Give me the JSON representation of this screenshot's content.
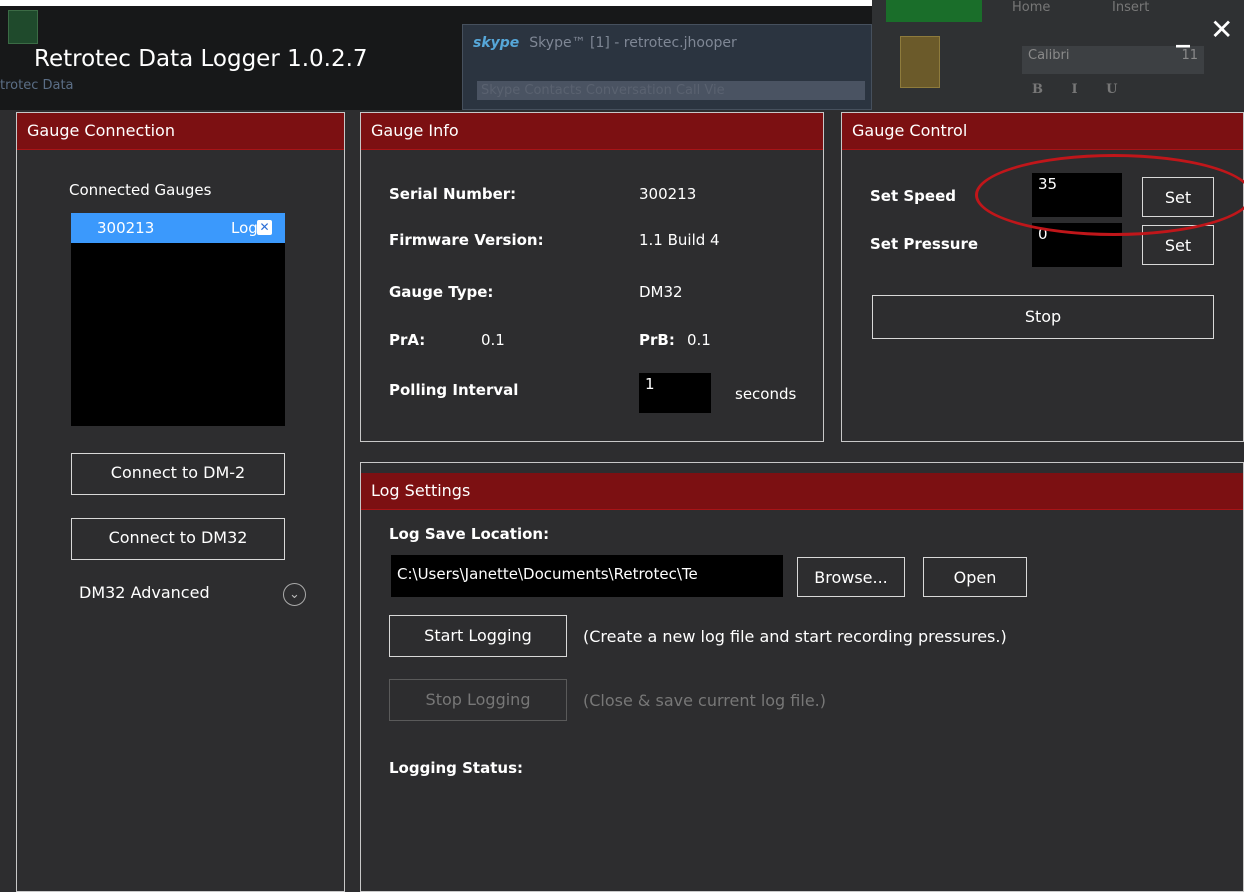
{
  "background": {
    "left_text": "trotec Data",
    "skype_logo": "skype",
    "skype_title": "Skype™ [1] - retrotec.jhooper",
    "skype_menu": "Skype   Contacts   Conversation   Call   Vie",
    "office_home": "Home",
    "office_insert": "Insert",
    "office_font": "Calibri",
    "office_size": "11",
    "office_format": "B I U"
  },
  "window": {
    "title": "Retrotec Data Logger 1.0.2.7",
    "minimize": "_",
    "close": "✕"
  },
  "gauge_connection": {
    "header": "Gauge Connection",
    "list_label": "Connected Gauges",
    "gauges": [
      {
        "serial": "300213",
        "log_label": "Log"
      }
    ],
    "connect_dm2": "Connect to DM-2",
    "connect_dm32": "Connect to DM32",
    "advanced_label": "DM32 Advanced"
  },
  "gauge_info": {
    "header": "Gauge Info",
    "serial_label": "Serial Number:",
    "serial_value": "300213",
    "firmware_label": "Firmware Version:",
    "firmware_value": "1.1 Build 4",
    "type_label": "Gauge Type:",
    "type_value": "DM32",
    "pra_label": "PrA:",
    "pra_value": "0.1",
    "prb_label": "PrB:",
    "prb_value": "0.1",
    "polling_label": "Polling Interval",
    "polling_value": "1",
    "polling_unit": "seconds"
  },
  "gauge_control": {
    "header": "Gauge Control",
    "speed_label": "Set Speed",
    "speed_value": "35",
    "pressure_label": "Set Pressure",
    "pressure_value": "0",
    "set_label": "Set",
    "stop_label": "Stop",
    "highlight_color": "#c0161a"
  },
  "log_settings": {
    "header": "Log Settings",
    "location_label": "Log Save Location:",
    "location_value": "C:\\Users\\Janette\\Documents\\Retrotec\\Te",
    "browse": "Browse...",
    "open": "Open",
    "start_label": "Start Logging",
    "start_desc": "(Create a new log file and start recording pressures.)",
    "stop_label": "Stop Logging",
    "stop_desc": "(Close & save current log file.)",
    "status_label": "Logging Status:"
  },
  "colors": {
    "panel_header": "#7c1012",
    "background": "#2d2d2f",
    "selection": "#3b99fc"
  }
}
